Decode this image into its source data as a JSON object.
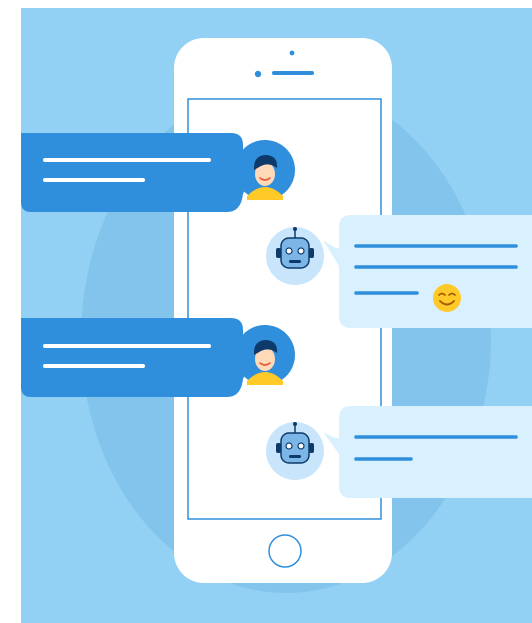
{
  "illustration": {
    "subject": "chatbot-conversation",
    "colors": {
      "background": "#93d1f4",
      "halo": "#7cbfea",
      "phone_body": "#ffffff",
      "phone_outline": "#2f8fdc",
      "user_bubble": "#2f8fdc",
      "bot_bubble": "#d9f0ff",
      "user_line": "#ffffff",
      "bot_line": "#2f8fdc",
      "emoji": "#ffc928"
    },
    "icons": [
      "user-avatar-icon",
      "robot-avatar-icon",
      "smiley-emoji-icon",
      "home-button-icon"
    ]
  }
}
